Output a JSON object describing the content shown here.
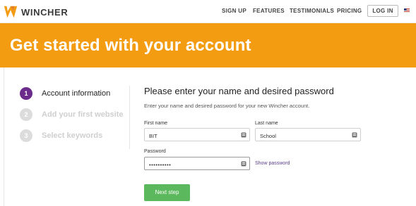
{
  "header": {
    "brand": "WINCHER",
    "nav": [
      "SIGN UP",
      "FEATURES",
      "TESTIMONIALS",
      "PRICING"
    ],
    "login_label": "LOG IN",
    "logo_icon": "wincher-w-logo",
    "flag_icon": "us-flag-icon"
  },
  "banner": {
    "title": "Get started with your account",
    "color": "#f39c12"
  },
  "steps": [
    {
      "num": "1",
      "label": "Account information",
      "active": true
    },
    {
      "num": "2",
      "label": "Add your first website",
      "active": false
    },
    {
      "num": "3",
      "label": "Select keywords",
      "active": false
    }
  ],
  "form": {
    "title": "Please enter your name and desired password",
    "description": "Enter your name and desired password for your new Wincher account.",
    "first_name_label": "First name",
    "first_name_value": "BIT",
    "last_name_label": "Last name",
    "last_name_value": "School",
    "password_label": "Password",
    "password_value": "••••••••••",
    "show_password": "Show password",
    "next_button": "Next step"
  },
  "colors": {
    "accent_orange": "#f39c12",
    "active_step": "#6b2c8c",
    "primary_button": "#5cb85c",
    "link": "#5a3e8a"
  }
}
